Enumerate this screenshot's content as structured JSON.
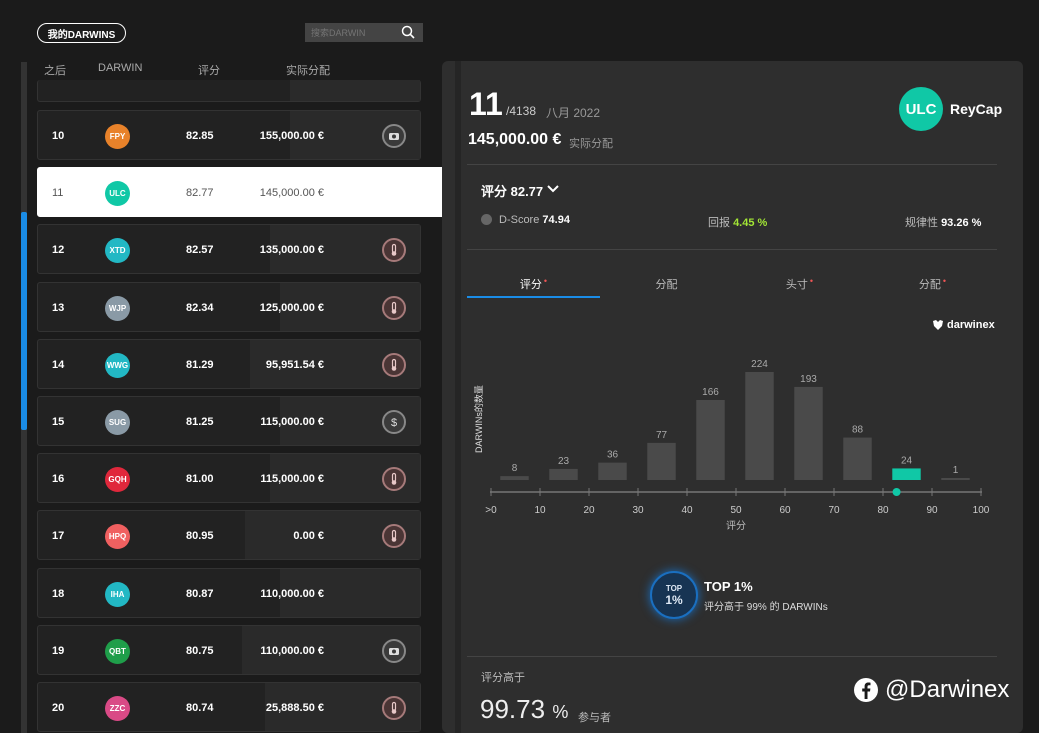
{
  "top": {
    "my_darwins": "我的DARWINS",
    "search_placeholder": "搜索DARWIN"
  },
  "list": {
    "headers": {
      "rank": "之后",
      "darwin": "DARWIN",
      "score": "评分",
      "alloc": "实际分配"
    },
    "rows": [
      {
        "rank": "10",
        "code": "FPY",
        "color": "#e8822a",
        "score": "82.85",
        "alloc": "155,000.00 €",
        "action": "investor"
      },
      {
        "rank": "11",
        "code": "ULC",
        "color": "#10c8a6",
        "score": "82.77",
        "alloc": "145,000.00 €",
        "action": "none",
        "selected": true
      },
      {
        "rank": "12",
        "code": "XTD",
        "color": "#22b8c4",
        "score": "82.57",
        "alloc": "135,000.00 €",
        "action": "thermo"
      },
      {
        "rank": "13",
        "code": "WJP",
        "color": "#8a9aa6",
        "score": "82.34",
        "alloc": "125,000.00 €",
        "action": "thermo"
      },
      {
        "rank": "14",
        "code": "WWG",
        "color": "#22b8c4",
        "score": "81.29",
        "alloc": "95,951.54 €",
        "action": "thermo"
      },
      {
        "rank": "15",
        "code": "SUG",
        "color": "#8a9aa6",
        "score": "81.25",
        "alloc": "115,000.00 €",
        "action": "dollar"
      },
      {
        "rank": "16",
        "code": "GQH",
        "color": "#e0283c",
        "score": "81.00",
        "alloc": "115,000.00 €",
        "action": "thermo"
      },
      {
        "rank": "17",
        "code": "HPQ",
        "color": "#f06060",
        "score": "80.95",
        "alloc": "0.00 €",
        "action": "thermo"
      },
      {
        "rank": "18",
        "code": "IHA",
        "color": "#22b8c4",
        "score": "80.87",
        "alloc": "110,000.00 €",
        "action": "none"
      },
      {
        "rank": "19",
        "code": "QBT",
        "color": "#1f9e4a",
        "score": "80.75",
        "alloc": "110,000.00 €",
        "action": "investor"
      },
      {
        "rank": "20",
        "code": "ZZC",
        "color": "#d94a86",
        "score": "80.74",
        "alloc": "25,888.50 €",
        "action": "thermo"
      }
    ]
  },
  "detail": {
    "rank": "11",
    "of_total": "/4138",
    "month": "八月 2022",
    "alloc": "145,000.00 €",
    "alloc_label": "实际分配",
    "code": "ULC",
    "name": "ReyCap",
    "score_label": "评分 82.77",
    "dscore_label": "D-Score",
    "dscore_value": "74.94",
    "return_label": "回报",
    "return_value": "4.45 %",
    "consistency_label": "规律性",
    "consistency_value": "93.26 %",
    "tabs": [
      "评分",
      "分配",
      "头寸",
      "分配"
    ],
    "brand": "darwinex",
    "top_title": "TOP 1%",
    "top_sub": "评分高于 99% 的 DARWINs",
    "top_badge_1": "TOP",
    "top_badge_2": "1%",
    "above_label": "评分高于",
    "above_value": "99.73",
    "above_unit": "%",
    "above_part": "参与者",
    "watermark": "@Darwinex"
  },
  "chart_data": {
    "type": "bar",
    "ylabel": "DARWINs的数量",
    "xlabel": "评分",
    "x_ticks": [
      ">0",
      "10",
      "20",
      "30",
      "40",
      "50",
      "60",
      "70",
      "80",
      "90",
      "100"
    ],
    "categories": [
      "0-10",
      "10-20",
      "20-30",
      "30-40",
      "40-50",
      "50-60",
      "60-70",
      "70-80",
      "80-90",
      "90-100"
    ],
    "values": [
      8,
      23,
      36,
      77,
      166,
      224,
      193,
      88,
      24,
      1
    ],
    "highlight_index": 8,
    "marker_value": 82.77,
    "colors": {
      "bar": "#4a4a4a",
      "highlight": "#10c8a6"
    }
  }
}
